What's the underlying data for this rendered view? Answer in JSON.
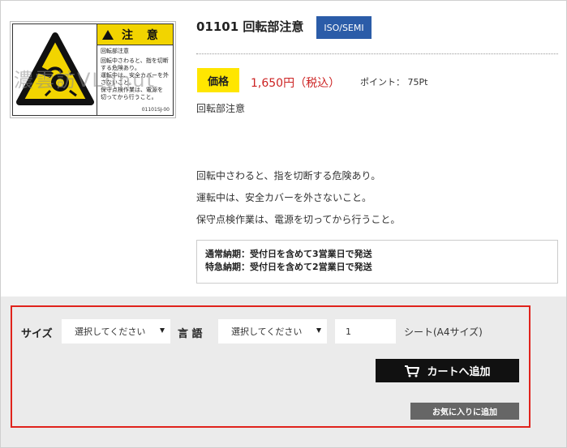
{
  "product": {
    "title": "01101 回転部注意",
    "badge": "ISO/SEMI",
    "price_label": "価格",
    "price": "1,650円（税込）",
    "points": "ポイント： 75Pt",
    "subtitle": "回転部注意",
    "description": [
      "回転中さわると、指を切断する危険あり。",
      "運転中は、安全カバーを外さないこと。",
      "保守点検作業は、電源を切ってから行うこと。"
    ],
    "delivery": [
      "通常納期：受付日を含めて3営業日で発送",
      "特急納期：受付日を含めて2営業日で発送"
    ]
  },
  "image": {
    "header": "注 意",
    "label_title": "回転部注意",
    "label_lines": [
      "回転中さわると、指を切断",
      "する危険あり。",
      "運転中は、安全カバーを外",
      "さないこと。",
      "保守点検作業は、電源を",
      "切ってから行うこと。"
    ],
    "code": "01101SJ-00",
    "watermark": "濃雲訪VLdnut",
    "colors": {
      "yellow": "#f2d400",
      "black": "#111111"
    }
  },
  "options": {
    "size_label": "サイズ",
    "size_select": "選択してください",
    "lang_label": "言 語",
    "lang_select": "選択してください",
    "quantity": "1",
    "unit": "シート(A4サイズ)",
    "cart_button": "カートへ追加",
    "favorite_button": "お気に入りに追加"
  },
  "colors": {
    "iso_badge": "#2b5ca8",
    "price_badge": "#ffe600",
    "price_text": "#cc2222",
    "highlight": "#e0231c"
  }
}
